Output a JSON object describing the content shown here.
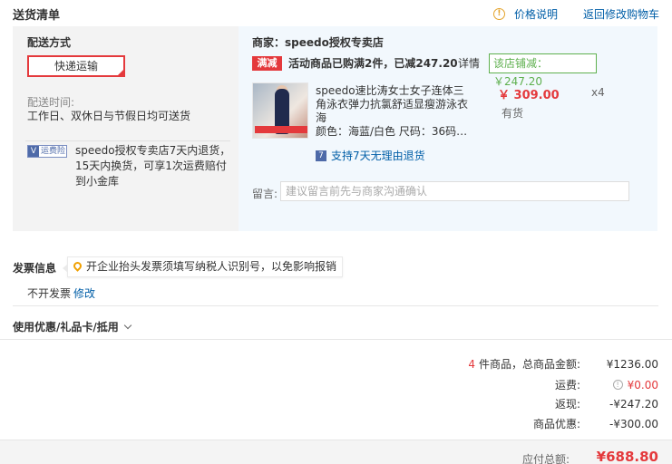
{
  "header": {
    "title": "送货清单",
    "price_info_label": "价格说明",
    "back_to_cart_label": "返回修改购物车"
  },
  "shipping": {
    "method_label": "配送方式",
    "method_value": "快递运输",
    "time_label": "配送时间:",
    "time_value": "工作日、双休日与节假日均可送货",
    "insurance_badge": "运费险",
    "insurance_text": "speedo授权专卖店7天内退货，15天内换货，可享1次运费赔付到小金库"
  },
  "store": {
    "name": "商家：speedo授权专卖店",
    "promo_tag": "满减",
    "promo_text": "活动商品已购满2件，已减247.20",
    "promo_detail": "详情",
    "discount_label": "该店铺减：￥247.20",
    "product": {
      "title": "speedo速比涛女士女子连体三角泳衣弹力抗氯舒适显瘦游泳衣 海",
      "price": "￥ 309.00",
      "qty": "x4",
      "stock": "有货",
      "attrs": "颜色：海蓝/白色 尺码：36码身...",
      "return_policy": "支持7天无理由退货"
    },
    "message_label": "留言:",
    "message_placeholder": "建议留言前先与商家沟通确认"
  },
  "invoice": {
    "label": "发票信息",
    "tip": "开企业抬头发票须填写纳税人识别号，以免影响报销",
    "value": "不开发票",
    "edit_label": "修改"
  },
  "coupon": {
    "label": "使用优惠/礼品卡/抵用"
  },
  "summary": {
    "item_count": "4",
    "item_total_label": "件商品，总商品金额:",
    "item_total_value": "¥1236.00",
    "shipping_label": "运费:",
    "shipping_value": "¥0.00",
    "rebate_label": "返现:",
    "rebate_value": "-¥247.20",
    "discount_label": "商品优惠:",
    "discount_value": "-¥300.00",
    "payable_label": "应付总额:",
    "payable_value": "¥688.80"
  },
  "colors": {
    "accent_red": "#e4393c",
    "link_blue": "#005ea7",
    "discount_green": "#5fb04f"
  }
}
